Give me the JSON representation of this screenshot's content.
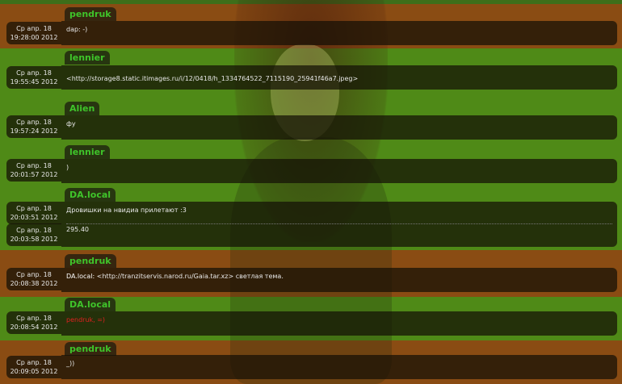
{
  "messages": [
    {
      "nick": "pendruk",
      "date": "Ср апр. 18",
      "time": "19:28:00 2012",
      "text": "dap: -)"
    },
    {
      "nick": "lennier",
      "date": "Ср апр. 18",
      "time": "19:55:45 2012",
      "text": "<http://storage8.static.itimages.ru/i/12/0418/h_1334764522_7115190_25941f46a7.jpeg>"
    },
    {
      "nick": "Alien",
      "date": "Ср апр. 18",
      "time": "19:57:24 2012",
      "text": "фу"
    },
    {
      "nick": "lennier",
      "date": "Ср апр. 18",
      "time": "20:01:57 2012",
      "text": ")"
    },
    {
      "nick": "DA.local",
      "date": "Ср апр. 18",
      "time": "20:03:51 2012",
      "text": "Дровишки на нвидиа прилетают :3",
      "date2": "Ср апр. 18",
      "time2": "20:03:58 2012",
      "text2": "295.40"
    },
    {
      "nick": "pendruk",
      "date": "Ср апр. 18",
      "time": "20:08:38 2012",
      "text_prefix": "DA.local:",
      "text": "<http://tranzitservis.narod.ru/Gaia.tar.xz> светлая тема."
    },
    {
      "nick": "DA.local",
      "date": "Ср апр. 18",
      "time": "20:08:54 2012",
      "text": "pendruk, =)"
    },
    {
      "nick": "pendruk",
      "date": "Ср апр. 18",
      "time": "20:09:05 2012",
      "text": "_))"
    }
  ],
  "colors": {
    "band_brown": "#8a4c13",
    "band_green": "#4f8a17",
    "nick": "#3fc42a",
    "highlight_text": "#e02020"
  }
}
